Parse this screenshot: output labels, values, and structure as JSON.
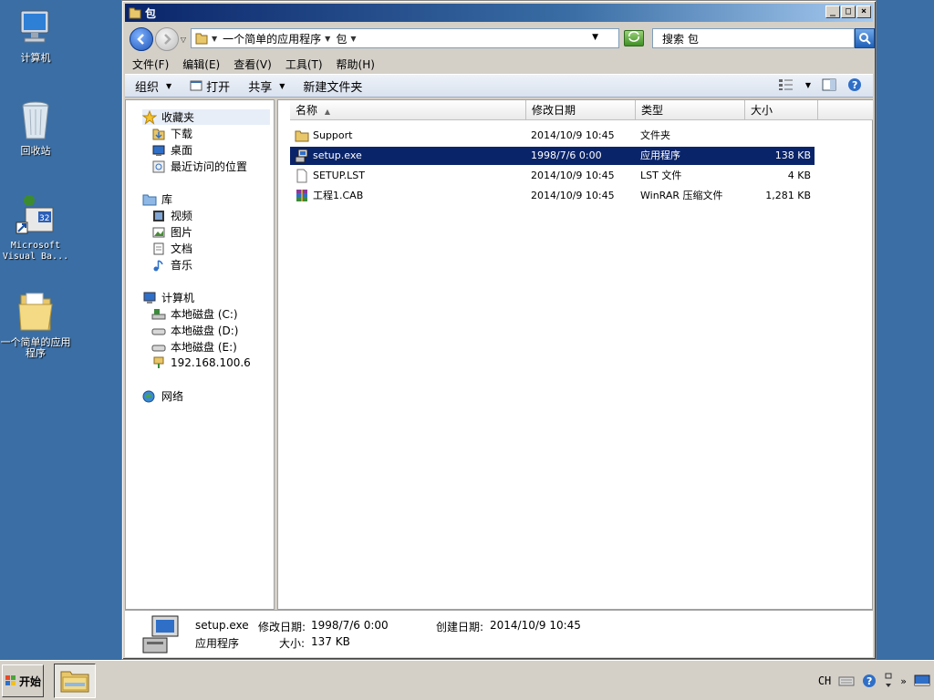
{
  "desktop": {
    "icons": [
      {
        "label": "计算机",
        "icon": "computer-icon"
      },
      {
        "label": "回收站",
        "icon": "recycle-bin-icon"
      },
      {
        "label": "Microsoft Visual Ba...",
        "icon": "vb6-icon"
      },
      {
        "label": "一个简单的应用程序",
        "icon": "folder-icon"
      }
    ]
  },
  "window": {
    "title": "包",
    "window_buttons": {
      "minimize": "_",
      "maximize": "□",
      "close": "×"
    },
    "address": {
      "segments": [
        "一个简单的应用程序",
        "包"
      ]
    },
    "search": {
      "placeholder": "搜索 包"
    },
    "menu": [
      "文件(F)",
      "编辑(E)",
      "查看(V)",
      "工具(T)",
      "帮助(H)"
    ],
    "toolbar": {
      "organize": "组织",
      "open": "打开",
      "share": "共享",
      "new_folder": "新建文件夹"
    },
    "nav": {
      "favorites": "收藏夹",
      "favorites_items": [
        "下载",
        "桌面",
        "最近访问的位置"
      ],
      "libraries": "库",
      "libraries_items": [
        "视频",
        "图片",
        "文档",
        "音乐"
      ],
      "computer": "计算机",
      "computer_items": [
        "本地磁盘 (C:)",
        "本地磁盘 (D:)",
        "本地磁盘 (E:)",
        "192.168.100.6"
      ],
      "network": "网络"
    },
    "columns": {
      "name": "名称",
      "date": "修改日期",
      "type": "类型",
      "size": "大小"
    },
    "files": [
      {
        "name": "Support",
        "date": "2014/10/9 10:45",
        "type": "文件夹",
        "size": "",
        "icon": "folder-icon"
      },
      {
        "name": "setup.exe",
        "date": "1998/7/6 0:00",
        "type": "应用程序",
        "size": "138 KB",
        "icon": "setup-exe-icon"
      },
      {
        "name": "SETUP.LST",
        "date": "2014/10/9 10:45",
        "type": "LST 文件",
        "size": "4 KB",
        "icon": "file-icon"
      },
      {
        "name": "工程1.CAB",
        "date": "2014/10/9 10:45",
        "type": "WinRAR 压缩文件",
        "size": "1,281 KB",
        "icon": "winrar-icon"
      }
    ],
    "selected_index": 1,
    "details": {
      "name": "setup.exe",
      "modified_label": "修改日期:",
      "modified": "1998/7/6 0:00",
      "created_label": "创建日期:",
      "created": "2014/10/9 10:45",
      "type": "应用程序",
      "size_label": "大小:",
      "size": "137 KB"
    }
  },
  "taskbar": {
    "start": "开始",
    "lang": "CH"
  }
}
